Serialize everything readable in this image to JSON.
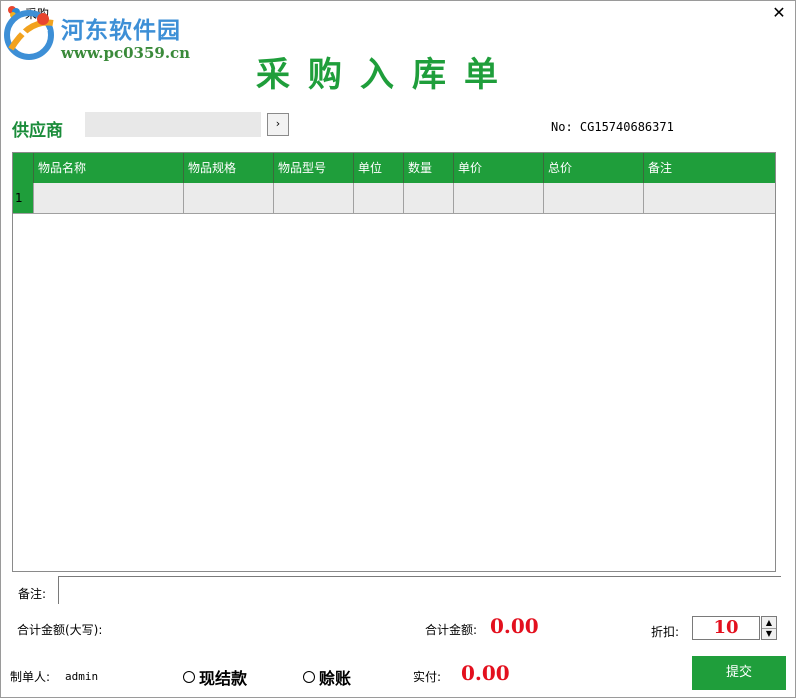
{
  "window": {
    "title": "采购"
  },
  "watermark": {
    "name": "河东软件园",
    "url": "www.pc0359.cn"
  },
  "document": {
    "title": "采购入库单"
  },
  "supplier": {
    "label": "供应商",
    "value": "",
    "button": "›"
  },
  "order": {
    "number": "No: CG15740686371"
  },
  "table": {
    "columns": [
      "物品名称",
      "物品规格",
      "物品型号",
      "单位",
      "数量",
      "单价",
      "总价",
      "备注"
    ],
    "rows": [
      {
        "num": "1",
        "cells": [
          "",
          "",
          "",
          "",
          "",
          "",
          "",
          ""
        ]
      }
    ]
  },
  "remark": {
    "label": "备注:",
    "value": ""
  },
  "totals": {
    "chinese_label": "合计金额(大写):",
    "amount_label": "合计金额:",
    "amount_value": "0.00",
    "discount_label": "折扣:",
    "discount_value": "10"
  },
  "footer": {
    "maker_label": "制单人:",
    "maker_value": "admin",
    "payment_cash": "现结款",
    "payment_credit": "赊账",
    "paid_label": "实付:",
    "paid_value": "0.00",
    "submit": "提交"
  },
  "colors": {
    "brand_green": "#1f9e3b",
    "amount_red": "#e3101e",
    "watermark_blue": "#3d8fd6"
  }
}
